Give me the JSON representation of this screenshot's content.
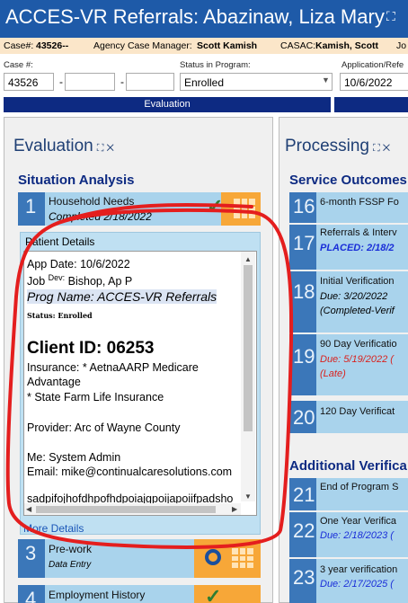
{
  "window": {
    "title": "ACCES-VR Referrals: Abazinaw, Liza Mary",
    "expand_icon": "⛶"
  },
  "info_bar": {
    "case_label": "Case#:",
    "case_value": "43526--",
    "manager_label": "Agency Case Manager:",
    "manager_value": "Scott Kamish",
    "casac_label": "CASAC:",
    "casac_value": "Kamish, Scott",
    "trailing": "Jo"
  },
  "form": {
    "case_label": "Case #:",
    "case_value": "43526",
    "case_sep1": "-",
    "case_sep2": "-",
    "status_label": "Status in Program:",
    "status_value": "Enrolled",
    "app_label": "Application/Refe",
    "app_value": "10/6/2022"
  },
  "tab_bar": {
    "evaluation": "Evaluation"
  },
  "evaluation": {
    "title": "Evaluation",
    "expand": "⛶ ✕",
    "section": "Situation Analysis",
    "items": [
      {
        "num": "1",
        "title": "Household Needs",
        "sub": "Completed 2/18/2022",
        "icon": "check-icon"
      },
      {
        "num": "3",
        "title": "Pre-work",
        "sub": "Data Entry",
        "icon": "circle-icon"
      },
      {
        "num": "4",
        "title": "Employment History",
        "sub": "",
        "icon": "check-icon"
      }
    ],
    "patient_details": {
      "header": "Patient Details",
      "app_date": "App Date: 10/6/2022",
      "job_prefix": "Job",
      "job_sup": "Dev:",
      "job_rest": " Bishop, Ap P",
      "prog_name": "Prog Name: ACCES-VR Referrals",
      "status": "Status: Enrolled",
      "client_id": "Client ID: 06253",
      "insurance_1": "Insurance: * AetnaAARP Medicare",
      "insurance_2": "Advantage",
      "insurance_3": "* State Farm Life Insurance",
      "provider": "Provider: Arc of Wayne County",
      "me": "Me: System Admin",
      "email": "Email: mike@continualcaresolutions.com",
      "junk": "sadpifojhofdhpofhdpoiajgpoijapoiifpadsho",
      "more": "More Details"
    }
  },
  "processing": {
    "title": "Processing",
    "expand": "⛶ ✕",
    "section1": "Service Outcomes",
    "items": [
      {
        "num": "16",
        "line1": "6-month FSSP Fo",
        "line2": "",
        "line3": ""
      },
      {
        "num": "17",
        "line1": "Referrals & Interv",
        "line2": "PLACED: 2/18/2",
        "line3": ""
      },
      {
        "num": "18",
        "line1": "Initial Verification",
        "line2": "Due: 3/20/2022",
        "line3": "(Completed-Verif"
      },
      {
        "num": "19",
        "line1": "90 Day Verificatio",
        "line2": "Due: 5/19/2022 (",
        "line3": "(Late)"
      },
      {
        "num": "20",
        "line1": "120 Day Verificat",
        "line2": "",
        "line3": ""
      }
    ],
    "section2": "Additional Verifica",
    "items2": [
      {
        "num": "21",
        "line1": "End of Program S",
        "line2": ""
      },
      {
        "num": "22",
        "line1": "One Year Verifica",
        "line2": "Due: 2/18/2023 ("
      },
      {
        "num": "23",
        "line1": "3 year verification",
        "line2": "Due: 2/17/2025 ("
      }
    ]
  },
  "colors": {
    "title_bar": "#1e5aa8",
    "info_bar": "#fbe6c9",
    "tab_bar": "#0d2a82",
    "row_bg": "#a9d3ec",
    "num_bg": "#3b77b9",
    "orange": "#f7a738",
    "red_annotation": "#e41e1e"
  }
}
